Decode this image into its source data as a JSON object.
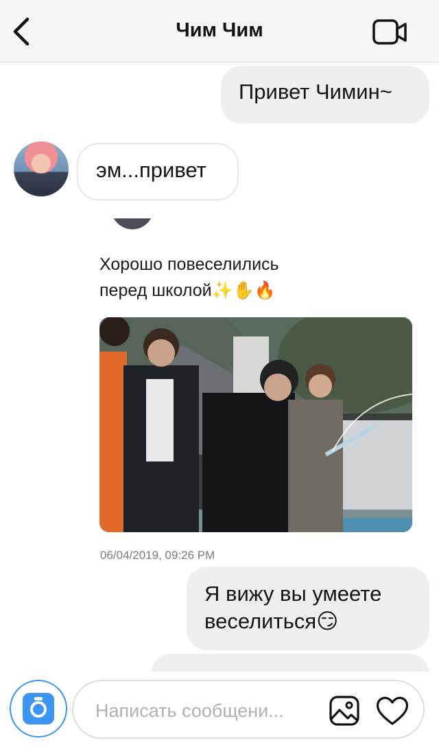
{
  "header": {
    "title": "Чим Чим"
  },
  "messages": {
    "m1": "Привет Чимин~",
    "m2": "эм...привет",
    "post_caption_line1": "Хорошо повеселились",
    "post_caption_line2": "перед школой✨✋🔥",
    "post_timestamp": "06/04/2019, 09:26 PM",
    "m3_line1": "Я вижу вы умеете",
    "m3_line2": "веселиться😏"
  },
  "composer": {
    "placeholder": "Написать сообщени..."
  },
  "icons": {
    "back": "chevron-left-icon",
    "video": "video-camera-icon",
    "camera": "camera-icon",
    "gallery": "image-icon",
    "heart": "heart-icon"
  },
  "colors": {
    "accent": "#3a96f0",
    "bubble_out": "#efeff1"
  }
}
